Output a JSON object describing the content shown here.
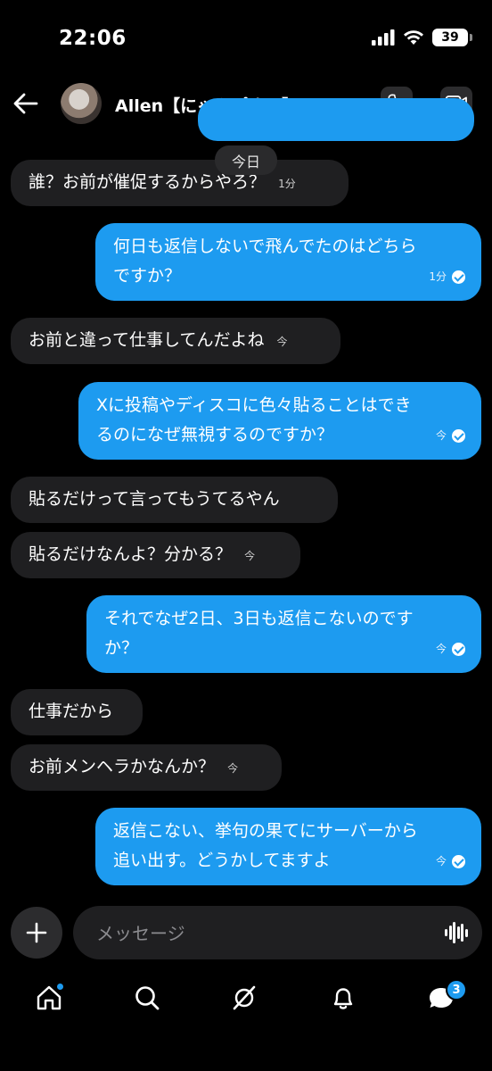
{
  "status_bar": {
    "time": "22:06",
    "battery": "39"
  },
  "header": {
    "contact_name": "Allen【にゃんぱす〜】"
  },
  "date_separator": "今日",
  "messages": [
    {
      "dir": "in",
      "text": "誰？お前が催促するからやろ？",
      "time": "1分"
    },
    {
      "dir": "out",
      "lines": [
        "何日も返信しないで飛んでたのはどちら",
        "ですか？"
      ],
      "time": "1分",
      "read": true
    },
    {
      "dir": "in",
      "text": "お前と違って仕事してんだよね",
      "time": "今"
    },
    {
      "dir": "out",
      "lines": [
        "Xに投稿やディスコに色々貼ることはでき",
        "るのになぜ無視するのですか？"
      ],
      "time": "今",
      "read": true
    },
    {
      "dir": "in",
      "text": "貼るだけって言ってもうてるやん",
      "time": ""
    },
    {
      "dir": "in",
      "text": "貼るだけなんよ？分かる？",
      "time": "今"
    },
    {
      "dir": "out",
      "lines": [
        "それでなぜ2日、3日も返信こないのです",
        "か？"
      ],
      "time": "今",
      "read": true
    },
    {
      "dir": "in",
      "text": "仕事だから",
      "time": ""
    },
    {
      "dir": "in",
      "text": "お前メンヘラかなんか？",
      "time": "今"
    },
    {
      "dir": "out",
      "lines": [
        "返信こない、挙句の果てにサーバーから",
        "追い出す。どうかしてますよ"
      ],
      "time": "今",
      "read": true
    }
  ],
  "composer": {
    "placeholder": "メッセージ"
  },
  "tab_bar": {
    "icons": [
      "home-icon",
      "search-icon",
      "grok-icon",
      "bell-icon",
      "messages-icon"
    ],
    "messages_badge": "3"
  },
  "colors": {
    "outgoing_bubble": "#1d9bf0",
    "incoming_bubble": "#1f1f21",
    "background": "#000000"
  }
}
